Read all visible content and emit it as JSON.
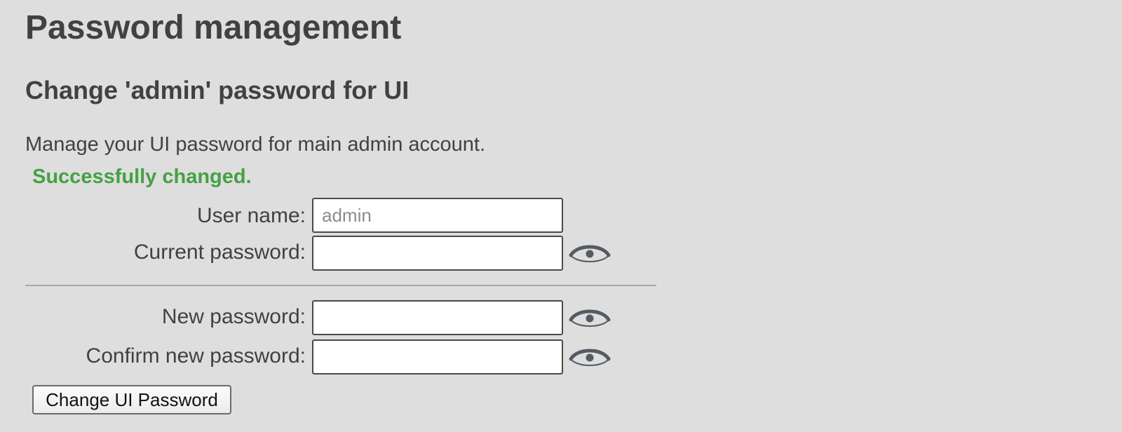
{
  "page": {
    "title": "Password management"
  },
  "section": {
    "title": "Change 'admin' password for UI",
    "description": "Manage your UI password for main admin account.",
    "status_message": "Successfully changed.",
    "status_color": "#45a142"
  },
  "form": {
    "username": {
      "label": "User name:",
      "placeholder": "admin",
      "value": ""
    },
    "current_password": {
      "label": "Current password:",
      "value": "",
      "icon": "eye-icon"
    },
    "new_password": {
      "label": "New password:",
      "value": "",
      "icon": "eye-icon"
    },
    "confirm_password": {
      "label": "Confirm new password:",
      "value": "",
      "icon": "eye-icon"
    },
    "submit_label": "Change UI Password"
  },
  "colors": {
    "background": "#dedede",
    "text": "#414141",
    "success": "#45a142",
    "icon": "#555a64"
  }
}
